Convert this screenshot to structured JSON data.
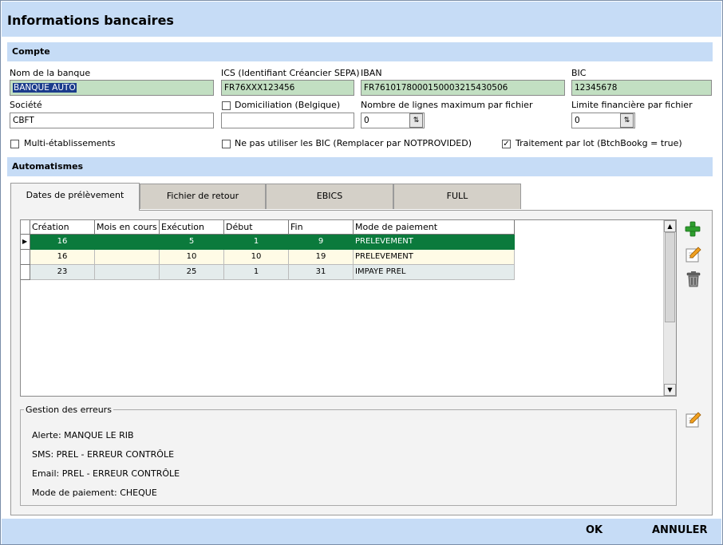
{
  "window": {
    "title": "Informations bancaires"
  },
  "sections": {
    "compte": "Compte",
    "automatismes": "Automatismes"
  },
  "compte": {
    "bank_name_label": "Nom de la banque",
    "bank_name_value": "BANQUE AUTO",
    "ics_label": "ICS (Identifiant Créancier SEPA)",
    "ics_value": "FR76XXX123456",
    "iban_label": "IBAN",
    "iban_value": "FR7610178000150003215430506",
    "bic_label": "BIC",
    "bic_value": "12345678",
    "societe_label": "Société",
    "societe_value": "CBFT",
    "domiciliation_label": "Domiciliation (Belgique)",
    "domiciliation_value": "",
    "max_lines_label": "Nombre de lignes maximum par fichier",
    "max_lines_value": "0",
    "limit_label": "Limite financière par fichier",
    "limit_value": "0",
    "multi_label": "Multi-établissements",
    "no_bic_label": "Ne pas utiliser les BIC (Remplacer par NOTPROVIDED)",
    "batch_label": "Traitement par lot (BtchBookg = true)",
    "check_mark": "✓"
  },
  "tabs": [
    {
      "label": "Dates de prélèvement"
    },
    {
      "label": "Fichier de retour"
    },
    {
      "label": "EBICS"
    },
    {
      "label": "FULL"
    }
  ],
  "grid": {
    "columns": [
      "Création",
      "Mois en cours",
      "Exécution",
      "Début",
      "Fin",
      "Mode de paiement"
    ],
    "rows": [
      [
        "16",
        "",
        "5",
        "1",
        "9",
        "PRELEVEMENT"
      ],
      [
        "16",
        "",
        "10",
        "10",
        "19",
        "PRELEVEMENT"
      ],
      [
        "23",
        "",
        "25",
        "1",
        "31",
        "IMPAYE PREL"
      ]
    ],
    "current_row_marker": "▶"
  },
  "errors": {
    "title": "Gestion des erreurs",
    "alerte": "Alerte: MANQUE LE RIB",
    "sms": "SMS: PREL - ERREUR CONTRÔLE",
    "email": "Email: PREL - ERREUR CONTRÔLE",
    "mode": "Mode de paiement: CHEQUE"
  },
  "actions": {
    "ok": "OK",
    "cancel": "ANNULER"
  },
  "icons": {
    "add": "plus-icon",
    "edit": "pencil-icon",
    "delete": "trash-icon",
    "spin": "spin-arrows-icon"
  },
  "colors": {
    "header_bg": "#c6dcf6",
    "selected_row": "#0b7a3c",
    "readonly_field": "#c2dfc2"
  }
}
